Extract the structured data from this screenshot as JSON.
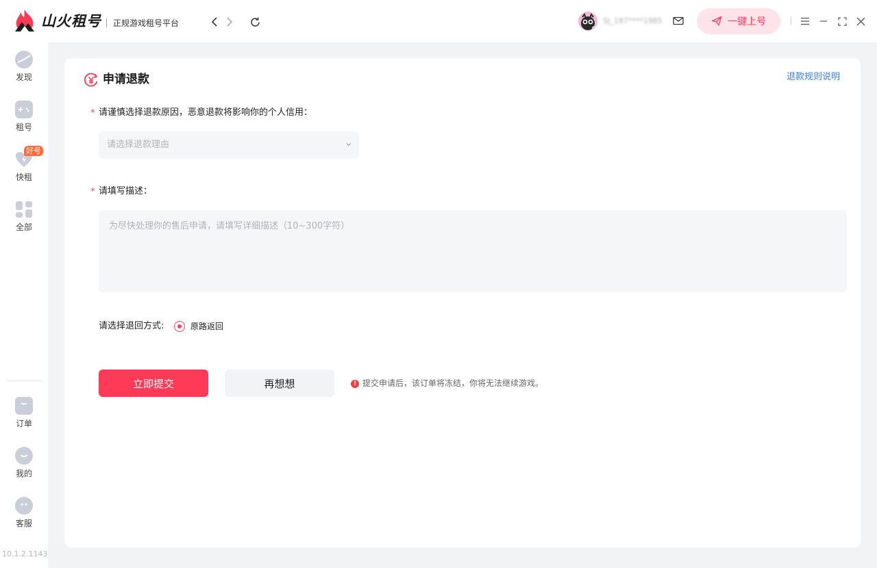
{
  "app": {
    "brand": "山火租号",
    "slogan": "正规游戏租号平台",
    "username": "SJ_187****1985",
    "quick_login": "一键上号"
  },
  "sidebar": {
    "items": [
      {
        "label": "发现",
        "icon": "planet-icon"
      },
      {
        "label": "租号",
        "icon": "gamepad-icon"
      },
      {
        "label": "快租",
        "icon": "heart-bolt-icon",
        "badge": "好号"
      },
      {
        "label": "全部",
        "icon": "grid-icon"
      },
      {
        "label": "订单",
        "icon": "order-icon"
      },
      {
        "label": "我的",
        "icon": "smile-icon"
      },
      {
        "label": "客服",
        "icon": "service-icon"
      }
    ],
    "version": "10.1.2.1143"
  },
  "refund": {
    "title": "申请退款",
    "rules_link": "退款规则说明",
    "required_mark": "*",
    "reason_label": "请谨慎选择退款原因，恶意退款将影响你的个人信用：",
    "reason_placeholder": "请选择退款理由",
    "desc_label": "请填写描述：",
    "desc_placeholder": "为尽快处理你的售后申请，请填写详细描述（10~300字符）",
    "method_label": "请选择退回方式:",
    "method_option": "原路返回",
    "submit": "立即提交",
    "cancel": "再想想",
    "warning": "提交申请后，该订单将冻结，你将无法继续游戏。"
  },
  "colors": {
    "accent": "#ff3a56",
    "link": "#3d7ff0",
    "background": "#f2f3f5"
  }
}
